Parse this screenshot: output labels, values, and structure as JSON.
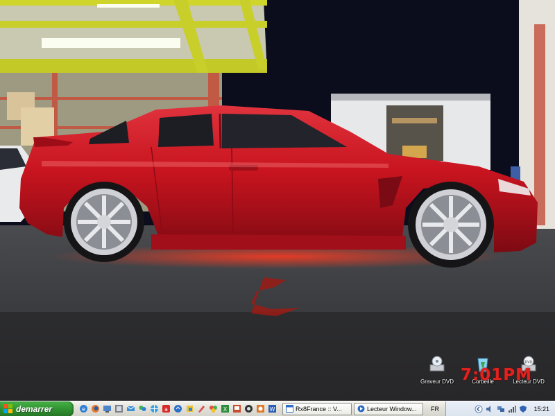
{
  "desktop": {
    "icons": [
      {
        "label": "Graveur DVD",
        "icon": "dvd-burner-icon"
      },
      {
        "label": "Corbeille",
        "icon": "recycle-bin-icon"
      },
      {
        "label": "Lecteur DVD",
        "icon": "dvd-drive-icon"
      }
    ],
    "overlay_clock": "7:01PM"
  },
  "taskbar": {
    "start_label": "demarrer",
    "quick_launch": [
      "internet-explorer-icon",
      "firefox-icon",
      "network-icon",
      "media-icon",
      "mail-icon",
      "messenger-icon",
      "globe-icon",
      "antivirus-icon",
      "update-icon",
      "paint-icon",
      "color-picker-icon",
      "folder-icon",
      "spreadsheet-icon",
      "presentation-icon",
      "pdf-icon",
      "photo-icon",
      "word-icon"
    ],
    "buttons": [
      {
        "label": "Rx8France :: V...",
        "icon": "browser-window-icon"
      },
      {
        "label": "Lecteur Window...",
        "icon": "media-player-icon"
      }
    ],
    "language": "FR",
    "tray_icons": [
      "volume-icon",
      "network-tray-icon",
      "signal-icon",
      "shield-tray-icon"
    ],
    "time": "15:21"
  },
  "colors": {
    "car": "#c8141f",
    "start": "#2f8f2f",
    "taskbar": "#e2e1da",
    "clock_overlay": "#e0231f"
  }
}
